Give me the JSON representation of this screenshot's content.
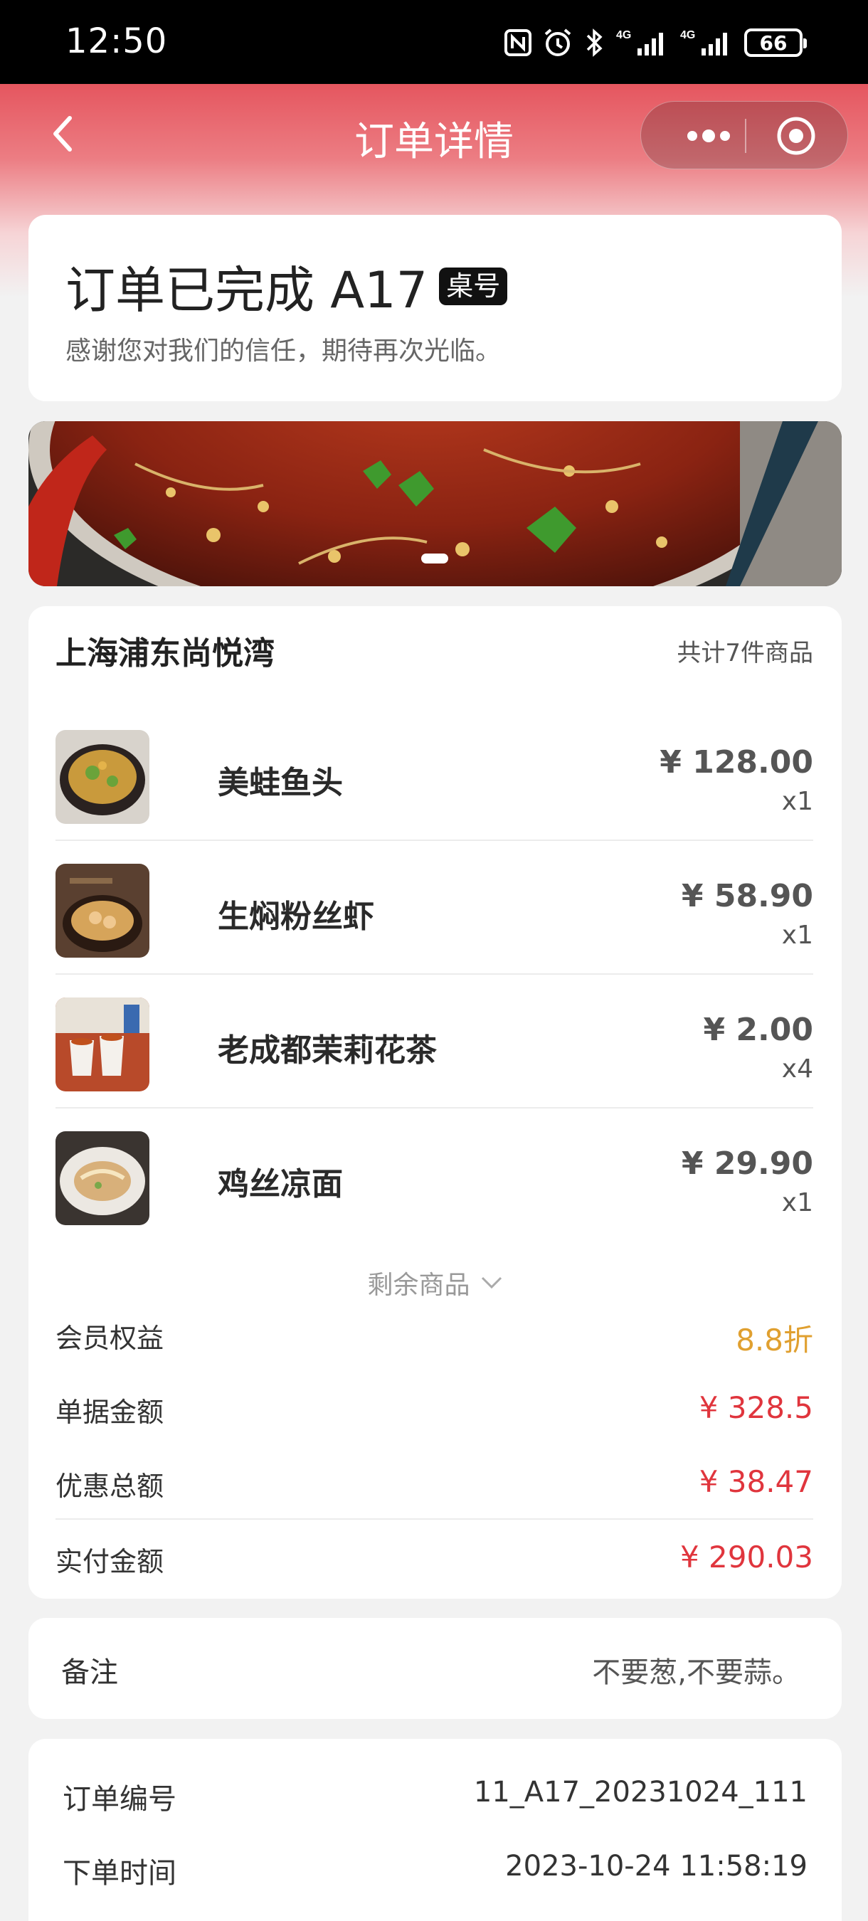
{
  "status_bar": {
    "time": "12:50",
    "battery": "66",
    "icons": [
      "nfc-icon",
      "alarm-icon",
      "bluetooth-icon",
      "signal-4g-icon",
      "signal-4g-icon",
      "battery-icon"
    ]
  },
  "navbar": {
    "title": "订单详情",
    "back_icon": "chevron-left-icon",
    "more_icon": "more-dots-icon",
    "close_icon": "target-circle-icon"
  },
  "order_status": {
    "title": "订单已完成 A17",
    "badge": "桌号",
    "subtitle": "感谢您对我们的信任，期待再次光临。"
  },
  "order": {
    "shop_name": "上海浦东尚悦湾",
    "item_count": "共计7件商品",
    "items": [
      {
        "name": "美蛙鱼头",
        "price": "¥ 128.00",
        "qty": "x1"
      },
      {
        "name": "生焖粉丝虾",
        "price": "¥ 58.90",
        "qty": "x1"
      },
      {
        "name": "老成都茉莉花茶",
        "price": "¥ 2.00",
        "qty": "x4"
      },
      {
        "name": "鸡丝凉面",
        "price": "¥ 29.90",
        "qty": "x1"
      }
    ],
    "more_label": "剩余商品",
    "summary": [
      {
        "label": "会员权益",
        "value": "8.8折"
      },
      {
        "label": "单据金额",
        "value": "¥ 328.5"
      },
      {
        "label": "优惠总额",
        "value": "¥ 38.47"
      },
      {
        "label": "实付金额",
        "value": "¥ 290.03"
      }
    ]
  },
  "remark": {
    "label": "备注",
    "value": "不要葱,不要蒜。"
  },
  "info": {
    "order_no_label": "订单编号",
    "order_no": "11_A17_20231024_111",
    "time_label": "下单时间",
    "time": "2023-10-24 11:58:19"
  },
  "colors": {
    "header_red": "#e5565f",
    "discount_orange": "#e0a030",
    "price_red": "#e0353d"
  }
}
